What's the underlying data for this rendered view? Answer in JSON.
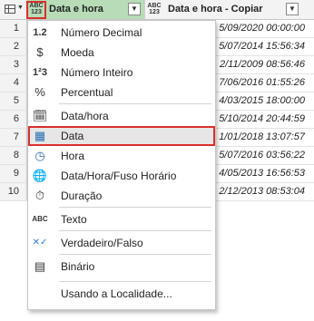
{
  "columns": [
    {
      "type_icon": "ABC 123",
      "name": "Data e hora"
    },
    {
      "type_icon": "ABC 123",
      "name": "Data e hora - Copiar"
    }
  ],
  "rows": [
    {
      "n": "1",
      "copy": "5/09/2020 00:00:00"
    },
    {
      "n": "2",
      "copy": "5/07/2014 15:56:34"
    },
    {
      "n": "3",
      "copy": "2/11/2009 08:56:46"
    },
    {
      "n": "4",
      "copy": "7/06/2016 01:55:26"
    },
    {
      "n": "5",
      "copy": "4/03/2015 18:00:00"
    },
    {
      "n": "6",
      "copy": "5/10/2014 20:44:59"
    },
    {
      "n": "7",
      "copy": "1/01/2018 13:07:57"
    },
    {
      "n": "8",
      "copy": "5/07/2016 03:56:22"
    },
    {
      "n": "9",
      "copy": "4/05/2013 16:56:53"
    },
    {
      "n": "10",
      "copy": "2/12/2013 08:53:04"
    }
  ],
  "menu": {
    "items": [
      {
        "icon": "1.2",
        "icon_name": "decimal-number-icon",
        "label": "Número Decimal"
      },
      {
        "icon": "$",
        "icon_name": "currency-icon",
        "label": "Moeda"
      },
      {
        "icon": "1²3",
        "icon_name": "whole-number-icon",
        "label": "Número Inteiro"
      },
      {
        "icon": "%",
        "icon_name": "percentage-icon",
        "label": "Percentual"
      },
      {
        "icon": "🗓",
        "icon_name": "datetime-icon",
        "label": "Data/hora"
      },
      {
        "icon": "▦",
        "icon_name": "date-icon",
        "label": "Data"
      },
      {
        "icon": "◷",
        "icon_name": "time-icon",
        "label": "Hora"
      },
      {
        "icon": "🌐",
        "icon_name": "datetime-timezone-icon",
        "label": "Data/Hora/Fuso Horário"
      },
      {
        "icon": "⏱",
        "icon_name": "duration-icon",
        "label": "Duração"
      },
      {
        "icon": "ABC",
        "icon_name": "text-icon",
        "label": "Texto"
      },
      {
        "icon": "✕✓",
        "icon_name": "true-false-icon",
        "label": "Verdadeiro/Falso"
      },
      {
        "icon": "▤",
        "icon_name": "binary-icon",
        "label": "Binário"
      },
      {
        "icon": "",
        "icon_name": "",
        "label": "Usando a Localidade..."
      }
    ]
  }
}
